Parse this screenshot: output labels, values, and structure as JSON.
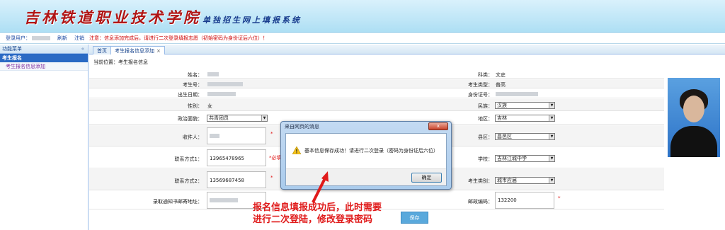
{
  "banner": {
    "school_name": "吉林铁道职业技术学院",
    "system_name": "单独招生网上填报系统"
  },
  "topbar": {
    "user_label": "登录用户：",
    "refresh": "刷新",
    "logout": "注销",
    "notice": "注意：信息添加完成后，请进行二次登录填报志愿（初始密码为身份证后六位）！"
  },
  "sidebar": {
    "header": "功能菜单",
    "collapse_icon": "double-chevron-left-icon",
    "group": "考生报名",
    "item": "考生报名信息添加"
  },
  "tabs": [
    {
      "label": "首页"
    },
    {
      "label": "考生报名信息添加",
      "close": "×"
    }
  ],
  "breadcrumb": "当前位置：考生报名信息",
  "form": {
    "name_label": "姓名：",
    "subject_label": "科类：",
    "subject_value": "文史",
    "exam_no_label": "考生号：",
    "type_label": "考生类型：",
    "type_value": "普高",
    "birth_label": "出生日期：",
    "id_label": "身份证号：",
    "gender_label": "性别：",
    "gender_value": "女",
    "ethnic_label": "民族：",
    "ethnic_value": "汉族",
    "politics_label": "政治面貌：",
    "politics_value": "共青团员",
    "region_label": "地区：",
    "region_value": "吉林",
    "receiver_label": "收件人：",
    "county_label": "县区：",
    "county_value": "昌邑区",
    "phone1_label": "联系方式1：",
    "phone1_value": "13965478965",
    "phone1_req": "*必填",
    "school_label": "学校：",
    "school_value": "吉林江城中学",
    "phone2_label": "联系方式2：",
    "phone2_value": "13569687458",
    "category_label": "考生类别：",
    "category_value": "城市应届",
    "address_label": "录取通知书邮寄地址：",
    "zip_label": "邮政编码：",
    "zip_value": "132200",
    "required_mark": "*",
    "save": "保存"
  },
  "dialog": {
    "title": "来自网页的消息",
    "close": "x",
    "icon": "warning-icon",
    "message": "基本信息保存成功！请进行二次登录（密码为身份证后六位）",
    "ok": "确定"
  },
  "annotation": {
    "line1": "报名信息填报成功后，此时需要",
    "line2": "进行二次登陆，修改登录密码"
  }
}
